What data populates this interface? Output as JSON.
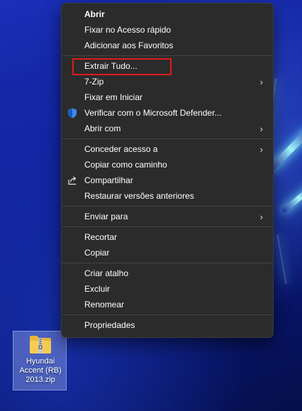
{
  "desktop": {
    "file": {
      "name_lines": [
        "Hyundai",
        "Accent (RB)",
        "2013.zip"
      ],
      "icon": "zip-folder-icon"
    }
  },
  "context_menu": {
    "groups": [
      {
        "items": [
          {
            "label": "Abrir",
            "bold": true
          },
          {
            "label": "Fixar no Acesso rápido"
          },
          {
            "label": "Adicionar aos Favoritos"
          }
        ]
      },
      {
        "items": [
          {
            "label": "Extrair Tudo...",
            "highlighted": true
          },
          {
            "label": "7-Zip",
            "submenu": true
          },
          {
            "label": "Fixar em Iniciar"
          },
          {
            "label": "Verificar com o Microsoft Defender...",
            "icon": "defender-shield-icon"
          },
          {
            "label": "Abrir com",
            "submenu": true
          }
        ]
      },
      {
        "items": [
          {
            "label": "Conceder acesso a",
            "submenu": true
          },
          {
            "label": "Copiar como caminho"
          },
          {
            "label": "Compartilhar",
            "icon": "share-icon"
          },
          {
            "label": "Restaurar versões anteriores"
          }
        ]
      },
      {
        "items": [
          {
            "label": "Enviar para",
            "submenu": true
          }
        ]
      },
      {
        "items": [
          {
            "label": "Recortar"
          },
          {
            "label": "Copiar"
          }
        ]
      },
      {
        "items": [
          {
            "label": "Criar atalho"
          },
          {
            "label": "Excluir"
          },
          {
            "label": "Renomear"
          }
        ]
      },
      {
        "items": [
          {
            "label": "Propriedades"
          }
        ]
      }
    ],
    "submenu_glyph": "›"
  },
  "colors": {
    "menu_bg": "#2b2b2b",
    "highlight_border": "#e01b1b",
    "text": "#ffffff"
  }
}
